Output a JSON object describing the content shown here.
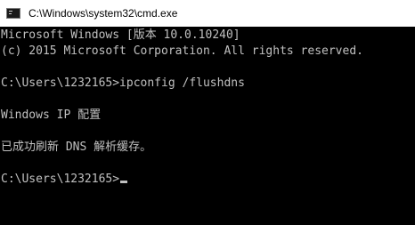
{
  "window": {
    "title": "C:\\Windows\\system32\\cmd.exe",
    "icon": "cmd-icon"
  },
  "console": {
    "lines": [
      "Microsoft Windows [版本 10.0.10240]",
      "(c) 2015 Microsoft Corporation. All rights reserved.",
      "",
      "C:\\Users\\1232165>ipconfig /flushdns",
      "",
      "Windows IP 配置",
      "",
      "已成功刷新 DNS 解析缓存。",
      "",
      "C:\\Users\\1232165>"
    ]
  },
  "colors": {
    "background": "#000000",
    "text": "#c0c0c0",
    "titlebar": "#ffffff"
  }
}
